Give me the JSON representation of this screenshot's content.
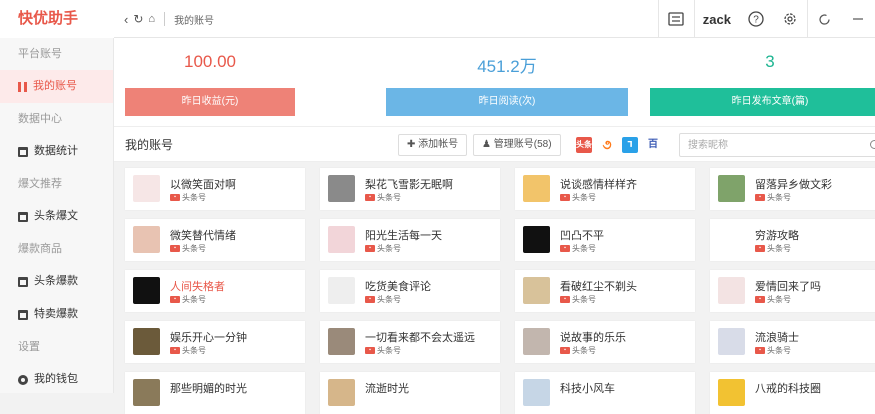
{
  "app": {
    "brand": "快优助手",
    "breadcrumb": "我的账号",
    "user": "zack"
  },
  "sidebar": {
    "sections": [
      {
        "title": "平台账号",
        "items": [
          {
            "label": "我的账号",
            "icon": "bar-icon",
            "active": true
          }
        ]
      },
      {
        "title": "数据中心",
        "items": [
          {
            "label": "数据统计",
            "icon": "calendar-icon"
          }
        ]
      },
      {
        "title": "爆文推荐",
        "items": [
          {
            "label": "头条爆文",
            "icon": "calendar-icon"
          }
        ]
      },
      {
        "title": "爆款商品",
        "items": [
          {
            "label": "头条爆款",
            "icon": "calendar-icon"
          },
          {
            "label": "特卖爆款",
            "icon": "calendar-icon"
          }
        ]
      },
      {
        "title": "设置",
        "items": [
          {
            "label": "我的钱包",
            "icon": "gear-icon"
          }
        ]
      }
    ]
  },
  "stats": [
    {
      "value": "100.00",
      "label": "昨日收益(元)",
      "color": "#ee8277",
      "text_color": "#e8584a"
    },
    {
      "value": "451.2万",
      "label": "昨日阅读(次)",
      "color": "#6bb6e6",
      "text_color": "#4a9fd8"
    },
    {
      "value": "3",
      "label": "昨日发布文章(篇)",
      "color": "#1fbf9a",
      "text_color": "#1fb592"
    }
  ],
  "list": {
    "title": "我的账号",
    "add_button": "添加帐号",
    "manage_button": "管理账号(58)",
    "search_placeholder": "搜索昵称",
    "platforms": [
      {
        "name": "头条",
        "color": "#e8584a",
        "glyph": "头条"
      },
      {
        "name": "uc",
        "color": "#ff7a1a",
        "glyph": "૭"
      },
      {
        "name": "百家号",
        "color": "#2aa1e8",
        "glyph": "⅂"
      },
      {
        "name": "网易",
        "color": "#3b5bb5",
        "glyph": "百"
      }
    ]
  },
  "accounts": [
    {
      "name": "以微笑面对啊",
      "platform": "头条号",
      "avatar": "#f6e6e6"
    },
    {
      "name": "梨花飞雪影无眠啊",
      "platform": "头条号",
      "avatar": "#8a8a8a"
    },
    {
      "name": "说谈感情样样齐",
      "platform": "头条号",
      "avatar": "#f2c46a"
    },
    {
      "name": "留落异乡做文彩",
      "platform": "头条号",
      "avatar": "#7fa36a"
    },
    {
      "name": "微笑替代情绪",
      "platform": "头条号",
      "avatar": "#e8c3b2"
    },
    {
      "name": "阳光生活每一天",
      "platform": "头条号",
      "avatar": "#f2d5d9"
    },
    {
      "name": "凹凸不平",
      "platform": "头条号",
      "avatar": "#111111"
    },
    {
      "name": "穷游攻略",
      "platform": "头条号",
      "avatar": "#ffffff"
    },
    {
      "name": "人间失格者",
      "platform": "头条号",
      "avatar": "#111111",
      "highlight": true
    },
    {
      "name": "吃货美食评论",
      "platform": "头条号",
      "avatar": "#eeeeee"
    },
    {
      "name": "看破红尘不剃头",
      "platform": "头条号",
      "avatar": "#d8c29a"
    },
    {
      "name": "爱情回来了吗",
      "platform": "头条号",
      "avatar": "#f3e3e3"
    },
    {
      "name": "娱乐开心一分钟",
      "platform": "头条号",
      "avatar": "#6b5a3a"
    },
    {
      "name": "一切看来都不会太遥远",
      "platform": "头条号",
      "avatar": "#9a8a7a"
    },
    {
      "name": "说故事的乐乐",
      "platform": "头条号",
      "avatar": "#c2b6ae"
    },
    {
      "name": "流浪骑士",
      "platform": "头条号",
      "avatar": "#d8dce8"
    },
    {
      "name": "那些明媚的时光",
      "platform": "",
      "avatar": "#8a7a5a"
    },
    {
      "name": "流逝时光",
      "platform": "",
      "avatar": "#d6b68a"
    },
    {
      "name": "科技小风车",
      "platform": "",
      "avatar": "#c6d6e6"
    },
    {
      "name": "八戒的科技圈",
      "platform": "",
      "avatar": "#f2c232"
    }
  ]
}
